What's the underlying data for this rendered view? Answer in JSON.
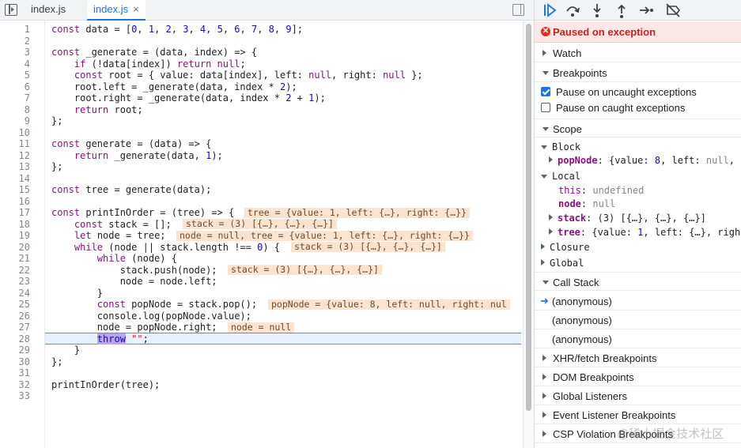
{
  "tabs": [
    {
      "label": "index.js",
      "active": false
    },
    {
      "label": "index.js",
      "active": true,
      "close_icon": "×"
    }
  ],
  "code": {
    "lines": [
      {
        "n": "1"
      },
      {
        "n": "2"
      },
      {
        "n": "3"
      },
      {
        "n": "4"
      },
      {
        "n": "5"
      },
      {
        "n": "6"
      },
      {
        "n": "7"
      },
      {
        "n": "8"
      },
      {
        "n": "9"
      },
      {
        "n": "10"
      },
      {
        "n": "11"
      },
      {
        "n": "12"
      },
      {
        "n": "13"
      },
      {
        "n": "14"
      },
      {
        "n": "15"
      },
      {
        "n": "16"
      },
      {
        "n": "17"
      },
      {
        "n": "18"
      },
      {
        "n": "19"
      },
      {
        "n": "20"
      },
      {
        "n": "21"
      },
      {
        "n": "22"
      },
      {
        "n": "23"
      },
      {
        "n": "24"
      },
      {
        "n": "25"
      },
      {
        "n": "26"
      },
      {
        "n": "27"
      },
      {
        "n": "28"
      },
      {
        "n": "29"
      },
      {
        "n": "30"
      },
      {
        "n": "31"
      },
      {
        "n": "32"
      },
      {
        "n": "33"
      }
    ],
    "inline_values": {
      "l17": "tree = {value: 1, left: {…}, right: {…}}",
      "l18": "stack = (3) [{…}, {…}, {…}]",
      "l19": "node = null, tree = {value: 1, left: {…}, right: {…}}",
      "l20": "stack = (3) [{…}, {…}, {…}]",
      "l22": "stack = (3) [{…}, {…}, {…}]",
      "l25": "popNode = {value: 8, left: null, right: nul",
      "l27": "node = null"
    }
  },
  "debugger": {
    "exception_banner": "Paused on exception",
    "sections": {
      "watch": "Watch",
      "breakpoints": "Breakpoints",
      "scope": "Scope",
      "call_stack": "Call Stack",
      "xhr": "XHR/fetch Breakpoints",
      "dom": "DOM Breakpoints",
      "global_listeners": "Global Listeners",
      "event_listener": "Event Listener Breakpoints",
      "csp": "CSP Violation Breakpoints"
    },
    "breakpoint_options": [
      {
        "label": "Pause on uncaught exceptions",
        "checked": true
      },
      {
        "label": "Pause on caught exceptions",
        "checked": false
      }
    ],
    "scope": {
      "block": "Block",
      "local": "Local",
      "closure": "Closure",
      "global": "Global"
    },
    "call_stack": [
      "(anonymous)",
      "(anonymous)",
      "(anonymous)"
    ]
  },
  "watermark": "@稀土掘金技术社区"
}
